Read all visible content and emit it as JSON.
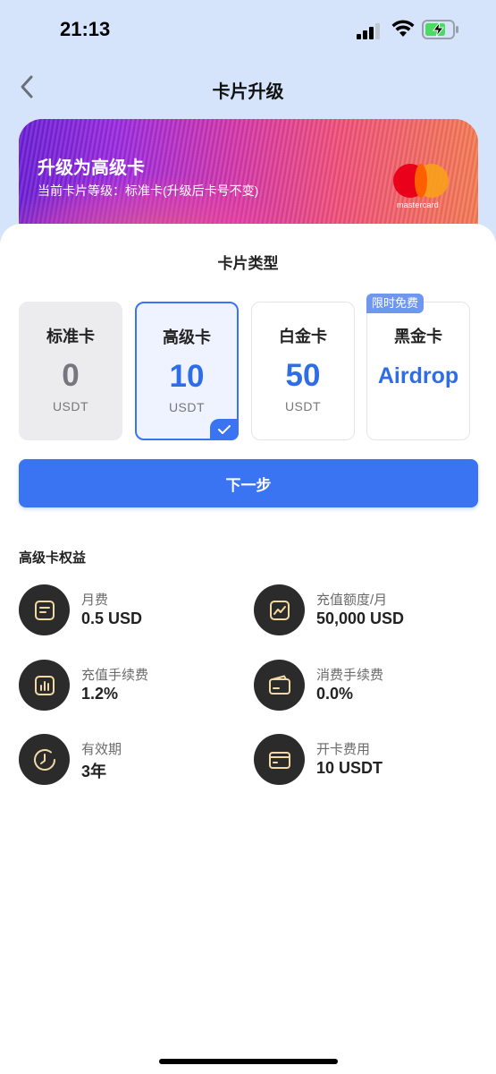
{
  "status_bar": {
    "time": "21:13"
  },
  "nav": {
    "title": "卡片升级",
    "back_icon": "chevron-left-icon"
  },
  "banner": {
    "title": "升级为高级卡",
    "subtitle": "当前卡片等级：标准卡(升级后卡号不变)",
    "brand": "mastercard"
  },
  "card_type": {
    "title": "卡片类型",
    "tiers": [
      {
        "name": "标准卡",
        "price": "0",
        "unit": "USDT",
        "state": "disabled"
      },
      {
        "name": "高级卡",
        "price": "10",
        "unit": "USDT",
        "state": "selected"
      },
      {
        "name": "白金卡",
        "price": "50",
        "unit": "USDT",
        "state": "normal"
      },
      {
        "name": "黑金卡",
        "price": "Airdrop",
        "badge": "限时免费",
        "state": "normal"
      }
    ],
    "next_button": "下一步"
  },
  "benefits": {
    "title": "高级卡权益",
    "items": [
      {
        "label": "月费",
        "value": "0.5 USD",
        "icon": "document-icon"
      },
      {
        "label": "充值额度/月",
        "value": "50,000 USD",
        "icon": "line-chart-icon"
      },
      {
        "label": "充值手续费",
        "value": "1.2%",
        "icon": "bar-chart-icon"
      },
      {
        "label": "消费手续费",
        "value": "0.0%",
        "icon": "wallet-card-icon"
      },
      {
        "label": "有效期",
        "value": "3年",
        "icon": "clock-icon"
      },
      {
        "label": "开卡费用",
        "value": "10 USDT",
        "icon": "credit-card-icon"
      }
    ]
  },
  "colors": {
    "accent": "#3b74f2",
    "icon_bg": "#2b2b2b",
    "icon_stroke": "#f3d9a4",
    "header_bg": "#d6e4fb"
  }
}
